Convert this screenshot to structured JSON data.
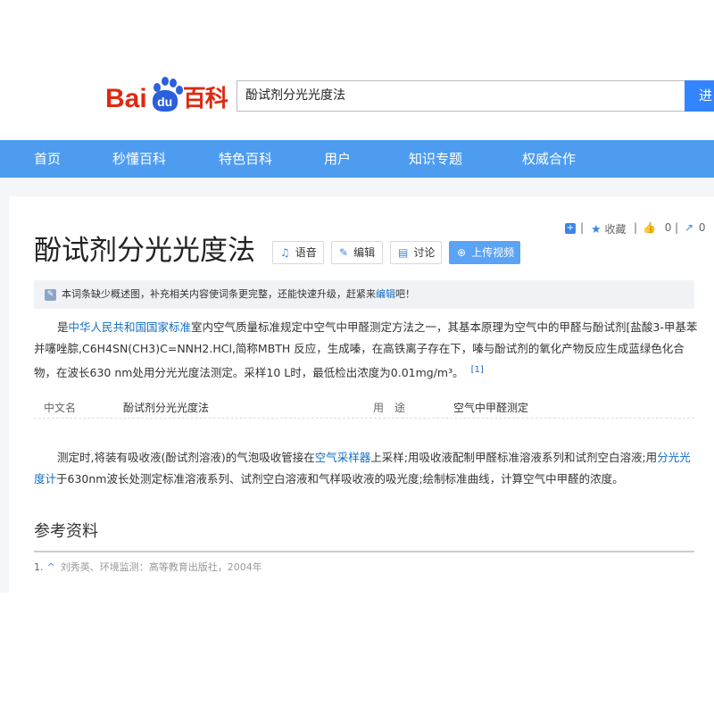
{
  "header": {
    "logo_bai": "Bai",
    "logo_du": "du",
    "logo_baike": "百科",
    "search_value": "酚试剂分光光度法",
    "search_button": "进"
  },
  "nav": [
    "首页",
    "秒懂百科",
    "特色百科",
    "用户",
    "知识专题",
    "权威合作"
  ],
  "tools": {
    "favorite_label": "收藏",
    "like_count": "0",
    "share_count": "0"
  },
  "title": "酚试剂分光光度法",
  "buttons": {
    "voice": "语音",
    "edit": "编辑",
    "discuss": "讨论",
    "upload_video": "上传视频"
  },
  "notice": {
    "text": "本词条缺少概述图，补充相关内容使词条更完整，还能快速升级，赶紧来",
    "link": "编辑",
    "suffix": "吧！"
  },
  "intro": {
    "pre": "是",
    "link": "中华人民共和国国家标准",
    "text": "室内空气质量标准规定中空气中甲醛测定方法之一，其基本原理为空气中的甲醛与酚试剂[盐酸3-甲基苯并噻唑腙,C6H4SN(CH3)C=NNH2.HCl,简称MBTH 反应，生成嗪，在高铁离子存在下，嗪与酚试剂的氧化产物反应生成蓝绿色化合物，在波长630 nm处用分光光度法测定。采样10 L时，最低检出浓度为0.01mg/m³。",
    "ref": "[1]"
  },
  "basic_info": {
    "name_key": "中文名",
    "name_value": "酚试剂分光光度法",
    "use_key": "用　途",
    "use_value": "空气中甲醛测定"
  },
  "method": {
    "p1": "测定时,将装有吸收液(酚试剂溶液)的气泡吸收管接在",
    "link1": "空气采样器",
    "p2": "上采样;用吸收液配制甲醛标准溶液系列和试剂空白溶液;用",
    "link2": "分光光度计",
    "p3": "于630nm波长处测定标准溶液系列、试剂空白溶液和气样吸收液的吸光度;绘制标准曲线，计算空气中甲醛的浓度。"
  },
  "references": {
    "heading": "参考资料",
    "items": [
      {
        "num": "1.",
        "text": "刘秀英、环境监测：高等教育出版社，2004年"
      }
    ]
  },
  "colors": {
    "nav_bg": "#4d9cf0",
    "link": "#136ec2",
    "logo_red": "#de2910",
    "logo_blue": "#2b5fdb"
  }
}
